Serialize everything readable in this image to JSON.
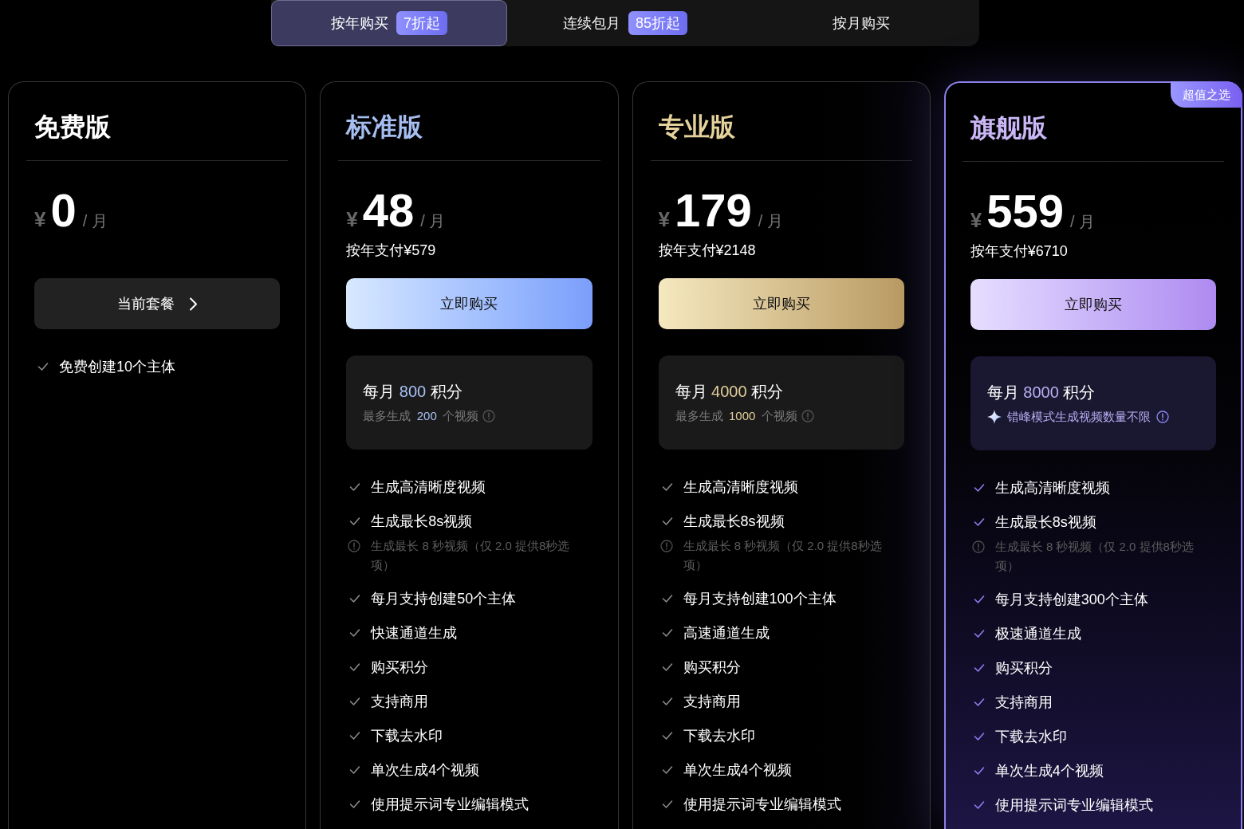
{
  "billing_tabs": [
    {
      "label": "按年购买",
      "badge": "7折起",
      "selected": true
    },
    {
      "label": "连续包月",
      "badge": "85折起",
      "selected": false
    },
    {
      "label": "按月购买",
      "selected": false
    }
  ],
  "plans": [
    {
      "kind": "free",
      "name": "免费版",
      "price": {
        "currency": "¥",
        "amount": "0",
        "period": "/ 月"
      },
      "action": {
        "kind": "current",
        "label": "当前套餐"
      },
      "features": [
        {
          "kind": "feature",
          "text": "免费创建10个主体"
        }
      ]
    },
    {
      "kind": "standard",
      "name": "标准版",
      "price": {
        "currency": "¥",
        "amount": "48",
        "period": "/ 月"
      },
      "annual_total": "按年支付¥579",
      "action": {
        "kind": "buy",
        "label": "立即购买"
      },
      "credits": {
        "prefix": "每月",
        "amount": "800",
        "unit": "积分",
        "detail": {
          "kind": "limit",
          "label": "最多生成",
          "count": "200",
          "unit": "个视频"
        }
      },
      "features": [
        {
          "kind": "feature",
          "text": "生成高清晰度视频"
        },
        {
          "kind": "feature",
          "text": "生成最长8s视频"
        },
        {
          "kind": "note",
          "text": "生成最长 8 秒视频（仅 2.0 提供8秒选项）"
        },
        {
          "kind": "feature",
          "text": "每月支持创建50个主体"
        },
        {
          "kind": "feature",
          "text": "快速通道生成"
        },
        {
          "kind": "feature",
          "text": "购买积分"
        },
        {
          "kind": "feature",
          "text": "支持商用"
        },
        {
          "kind": "feature",
          "text": "下载去水印"
        },
        {
          "kind": "feature",
          "text": "单次生成4个视频"
        },
        {
          "kind": "feature",
          "text": "使用提示词专业编辑模式"
        }
      ]
    },
    {
      "kind": "pro",
      "name": "专业版",
      "price": {
        "currency": "¥",
        "amount": "179",
        "period": "/ 月"
      },
      "annual_total": "按年支付¥2148",
      "action": {
        "kind": "buy",
        "label": "立即购买"
      },
      "credits": {
        "prefix": "每月",
        "amount": "4000",
        "unit": "积分",
        "detail": {
          "kind": "limit",
          "label": "最多生成",
          "count": "1000",
          "unit": "个视频"
        }
      },
      "features": [
        {
          "kind": "feature",
          "text": "生成高清晰度视频"
        },
        {
          "kind": "feature",
          "text": "生成最长8s视频"
        },
        {
          "kind": "note",
          "text": "生成最长 8 秒视频（仅 2.0 提供8秒选项）"
        },
        {
          "kind": "feature",
          "text": "每月支持创建100个主体"
        },
        {
          "kind": "feature",
          "text": "高速通道生成"
        },
        {
          "kind": "feature",
          "text": "购买积分"
        },
        {
          "kind": "feature",
          "text": "支持商用"
        },
        {
          "kind": "feature",
          "text": "下载去水印"
        },
        {
          "kind": "feature",
          "text": "单次生成4个视频"
        },
        {
          "kind": "feature",
          "text": "使用提示词专业编辑模式"
        }
      ]
    },
    {
      "kind": "flagship",
      "name": "旗舰版",
      "badge": "超值之选",
      "price": {
        "currency": "¥",
        "amount": "559",
        "period": "/ 月"
      },
      "annual_total": "按年支付¥6710",
      "action": {
        "kind": "buy",
        "label": "立即购买"
      },
      "credits": {
        "prefix": "每月",
        "amount": "8000",
        "unit": "积分",
        "detail": {
          "kind": "unlimited",
          "text": "错峰模式生成视频数量不限"
        }
      },
      "features": [
        {
          "kind": "feature",
          "text": "生成高清晰度视频"
        },
        {
          "kind": "feature",
          "text": "生成最长8s视频"
        },
        {
          "kind": "note",
          "text": "生成最长 8 秒视频（仅 2.0 提供8秒选项）"
        },
        {
          "kind": "feature",
          "text": "每月支持创建300个主体"
        },
        {
          "kind": "feature",
          "text": "极速通道生成"
        },
        {
          "kind": "feature",
          "text": "购买积分"
        },
        {
          "kind": "feature",
          "text": "支持商用"
        },
        {
          "kind": "feature",
          "text": "下载去水印"
        },
        {
          "kind": "feature",
          "text": "单次生成4个视频"
        },
        {
          "kind": "feature",
          "text": "使用提示词专业编辑模式"
        }
      ]
    }
  ]
}
